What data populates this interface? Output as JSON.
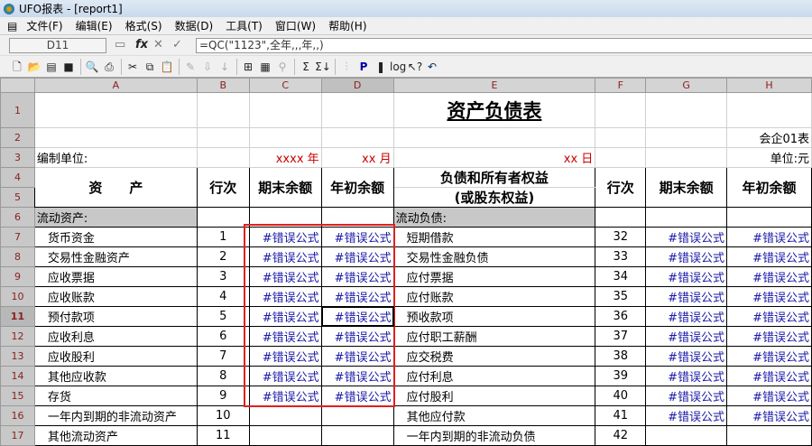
{
  "window": {
    "title": "UFO报表 - [report1]"
  },
  "menu": [
    "文件(F)",
    "编辑(E)",
    "格式(S)",
    "数据(D)",
    "工具(T)",
    "窗口(W)",
    "帮助(H)"
  ],
  "formula_bar": {
    "cell_ref": "D11",
    "formula": "=QC(\"1123\",全年,,,年,,)"
  },
  "columns": [
    "A",
    "B",
    "C",
    "D",
    "E",
    "F",
    "G",
    "H"
  ],
  "rows": [
    "1",
    "2",
    "3",
    "4",
    "5",
    "6",
    "7",
    "8",
    "9",
    "10",
    "11",
    "12",
    "13",
    "14",
    "15",
    "16",
    "17"
  ],
  "sheet": {
    "title": "资产负债表",
    "form_no": "会企01表",
    "compiler": "编制单位:",
    "year": "xxxx 年",
    "month": "xx 月",
    "day": "xx 日",
    "unit": "单位:元",
    "h_assets": "资　　产",
    "h_line": "行次",
    "h_end": "期末余额",
    "h_begin": "年初余额",
    "h_liab1": "负债和所有者权益",
    "h_liab2": "(或股东权益)",
    "cur_assets": "流动资产:",
    "cur_liab": "流动负债:",
    "err": "#错误公式",
    "lines": [
      {
        "a": "货币资金",
        "b": "1",
        "cd": true,
        "e": "短期借款",
        "f": "32",
        "gh": true
      },
      {
        "a": "交易性金融资产",
        "b": "2",
        "cd": true,
        "e": "交易性金融负债",
        "f": "33",
        "gh": true
      },
      {
        "a": "应收票据",
        "b": "3",
        "cd": true,
        "e": "应付票据",
        "f": "34",
        "gh": true
      },
      {
        "a": "应收账款",
        "b": "4",
        "cd": true,
        "e": "应付账款",
        "f": "35",
        "gh": true
      },
      {
        "a": "预付款项",
        "b": "5",
        "cd": true,
        "e": "预收款项",
        "f": "36",
        "gh": true
      },
      {
        "a": "应收利息",
        "b": "6",
        "cd": true,
        "e": "应付职工薪酬",
        "f": "37",
        "gh": true
      },
      {
        "a": "应收股利",
        "b": "7",
        "cd": true,
        "e": "应交税费",
        "f": "38",
        "gh": true
      },
      {
        "a": "其他应收款",
        "b": "8",
        "cd": true,
        "e": "应付利息",
        "f": "39",
        "gh": true
      },
      {
        "a": "存货",
        "b": "9",
        "cd": true,
        "e": "应付股利",
        "f": "40",
        "gh": true
      },
      {
        "a": "一年内到期的非流动资产",
        "b": "10",
        "cd": false,
        "e": "其他应付款",
        "f": "41",
        "gh": true
      },
      {
        "a": "其他流动资产",
        "b": "11",
        "cd": false,
        "e": "一年内到期的非流动负债",
        "f": "42",
        "gh": false
      }
    ]
  }
}
